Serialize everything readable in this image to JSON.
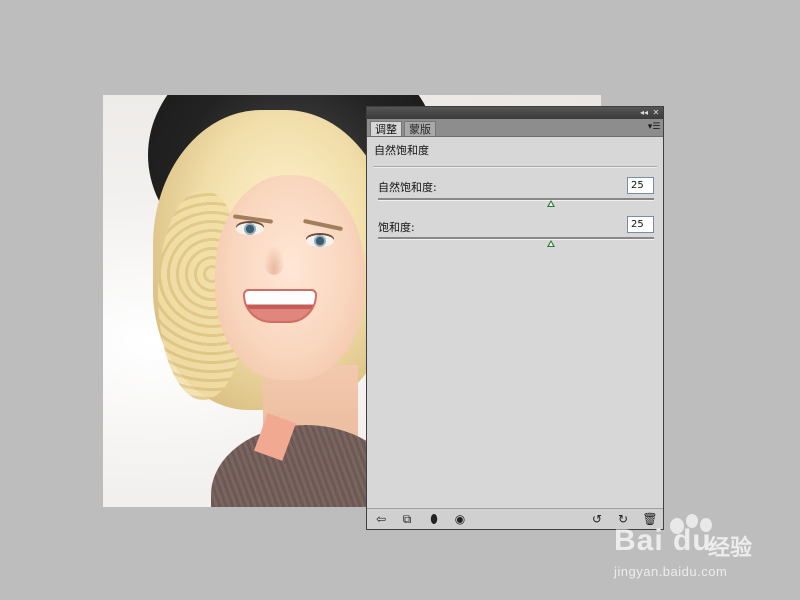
{
  "canvas": {
    "description_icon": "portrait-photo"
  },
  "panel": {
    "titlebar_buttons": [
      "◂◂",
      "✕"
    ],
    "tabs": [
      {
        "label": "调整",
        "active": true
      },
      {
        "label": "蒙版",
        "active": false
      }
    ],
    "menu_icon": "panel-menu-icon",
    "preset_title": "自然饱和度",
    "sliders": [
      {
        "label": "自然饱和度:",
        "value": "25",
        "fraction": 0.625
      },
      {
        "label": "饱和度:",
        "value": "25",
        "fraction": 0.625
      }
    ],
    "bottom_icons": [
      {
        "name": "back-arrow-icon",
        "glyph": "⇦"
      },
      {
        "name": "clip-to-layer-icon",
        "glyph": "⧉"
      },
      {
        "name": "mask-icon",
        "glyph": "⬮"
      },
      {
        "name": "visibility-eye-icon",
        "glyph": "◉"
      },
      {
        "name": "view-previous-icon",
        "glyph": "↺"
      },
      {
        "name": "reset-icon",
        "glyph": "↻"
      },
      {
        "name": "delete-trash-icon",
        "glyph": "🗑"
      }
    ]
  },
  "watermark": {
    "brand": "Bai du",
    "jingyan": "经验",
    "url": "jingyan.baidu.com"
  },
  "colors": {
    "workspace": "#bdbdbd",
    "panel_bg": "#d7d7d7",
    "slider_thumb": "#2d7a2d"
  }
}
